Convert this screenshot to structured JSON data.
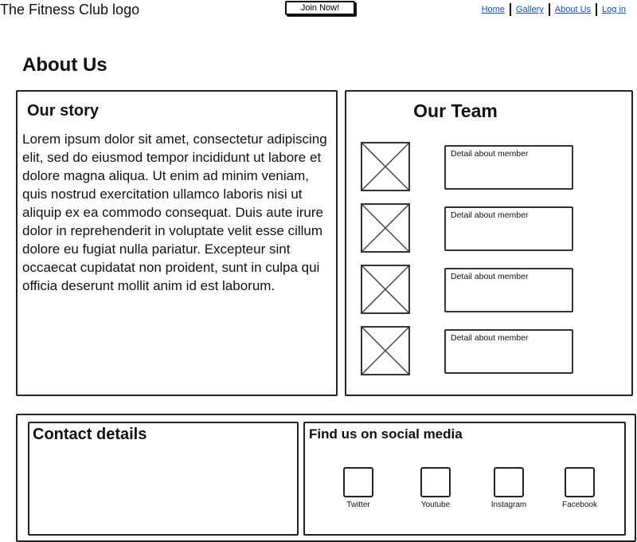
{
  "header": {
    "logo_text": "The Fitness Club logo",
    "join_label": "Join Now!",
    "nav": [
      "Home",
      "Gallery",
      "About Us",
      "Log in"
    ]
  },
  "page_title": "About Us",
  "story": {
    "heading": "Our story",
    "text": "Lorem ipsum dolor sit amet, consectetur adipiscing elit, sed do eiusmod tempor incididunt ut labore et dolore magna aliqua. Ut enim ad minim veniam, quis nostrud exercitation ullamco laboris nisi ut aliquip ex ea commodo consequat. Duis aute irure dolor in reprehenderit in voluptate velit esse cillum dolore eu fugiat nulla pariatur. Excepteur sint occaecat cupidatat non proident, sunt in culpa qui officia deserunt mollit anim id est laborum."
  },
  "team": {
    "heading": "Our Team",
    "members": [
      {
        "detail": "Detail about member"
      },
      {
        "detail": "Detail about member"
      },
      {
        "detail": "Detail about member"
      },
      {
        "detail": "Detail about member"
      }
    ]
  },
  "contact": {
    "heading": "Contact details"
  },
  "social": {
    "heading": "Find us on social media",
    "items": [
      {
        "label": "Twitter",
        "icon": "twitter-icon"
      },
      {
        "label": "Youtube",
        "icon": "youtube-icon"
      },
      {
        "label": "Instagram",
        "icon": "instagram-icon"
      },
      {
        "label": "Facebook",
        "icon": "facebook-icon"
      }
    ]
  }
}
